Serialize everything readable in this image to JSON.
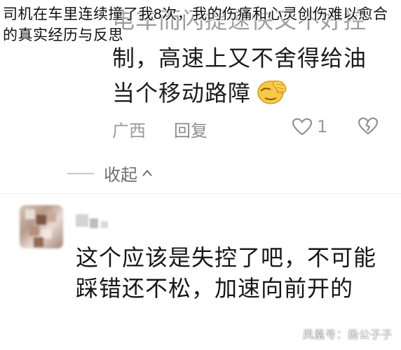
{
  "title": "司机在车里连续撞了我8次，我的伤痛和心灵创伤难以愈合的真实经历与反思",
  "prev_comment": {
    "line1": "电车而闪提速快又不好控",
    "line2": "制，高速上又不舍得给油",
    "line3": "当个移动路障",
    "emoji_icon": "facepalm-emoji",
    "region": "广西",
    "reply_label": "回复",
    "like_count": "1"
  },
  "collapse_label": "收起",
  "comment": {
    "text": "这个应该是失控了吧，不可能踩错还不松，加速向前开的"
  },
  "watermark": "凤凰号：扬公子子",
  "colors": {
    "text": "#161616",
    "meta": "#9a9a9a",
    "background": "#ffffff"
  }
}
